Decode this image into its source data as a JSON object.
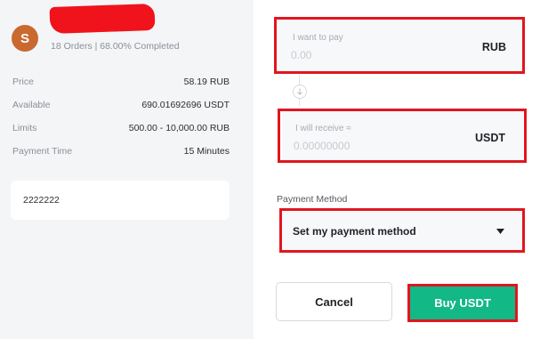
{
  "seller": {
    "avatar_letter": "S",
    "stats": "18 Orders | 68.00% Completed"
  },
  "details": [
    {
      "label": "Price",
      "value": "58.19 RUB"
    },
    {
      "label": "Available",
      "value": "690.01692696 USDT"
    },
    {
      "label": "Limits",
      "value": "500.00 - 10,000.00 RUB"
    },
    {
      "label": "Payment Time",
      "value": "15 Minutes"
    }
  ],
  "remark": "2222222",
  "pay": {
    "label": "I want to pay",
    "placeholder": "0.00",
    "currency": "RUB"
  },
  "receive": {
    "label": "I will receive ≈",
    "placeholder": "0.00000000",
    "currency": "USDT"
  },
  "payment_method": {
    "label": "Payment Method",
    "selected": "Set my payment method"
  },
  "buttons": {
    "cancel": "Cancel",
    "buy": "Buy USDT"
  },
  "colors": {
    "highlight": "#e0161f",
    "buy_button": "#12b886",
    "avatar": "#c9692f",
    "redaction": "#f0131c"
  },
  "icons": [
    "arrow-down-icon",
    "caret-down-icon"
  ]
}
